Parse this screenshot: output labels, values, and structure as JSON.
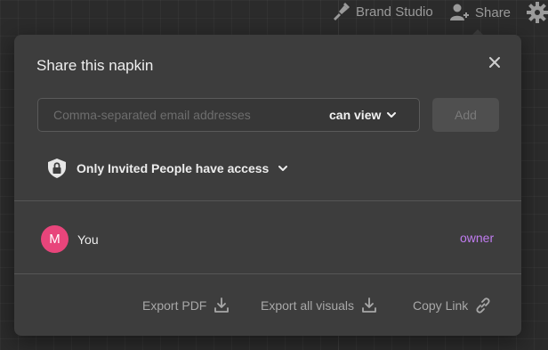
{
  "toolbar": {
    "brand_studio_label": "Brand Studio",
    "share_label": "Share",
    "brand_icon": "paint-brush-icon",
    "share_icon": "add-user-icon",
    "settings_icon": "gear-icon"
  },
  "modal": {
    "title": "Share this napkin",
    "email_placeholder": "Comma-separated email addresses",
    "email_value": "",
    "permission_selected": "can view",
    "add_label": "Add",
    "access_label": "Only Invited People have access",
    "members": [
      {
        "initial": "M",
        "name": "You",
        "role": "owner"
      }
    ],
    "footer": {
      "export_pdf": "Export PDF",
      "export_visuals": "Export all visuals",
      "copy_link": "Copy Link"
    }
  },
  "colors": {
    "background": "#2b2b2b",
    "modal": "#3d3d3d",
    "avatar": "#e8457b",
    "owner_role": "#c07cf0"
  }
}
